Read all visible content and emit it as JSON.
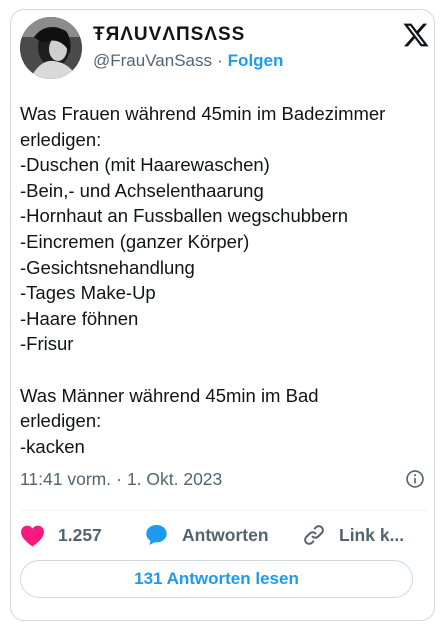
{
  "author": {
    "display_name": "ŦЯΛUVΛПSΛSS",
    "handle": "@FrauVanSass",
    "separator": "·",
    "follow_label": "Folgen"
  },
  "platform_icon": "x-logo-icon",
  "tweet": {
    "lines": [
      "Was Frauen während 45min im Badezimmer",
      "erledigen:",
      "-Duschen (mit Haarewaschen)",
      "-Bein,- und Achselenthaarung",
      "-Hornhaut an Fussballen wegschubbern",
      "-Eincremen (ganzer Körper)",
      "-Gesichtsnehandlung",
      "-Tages Make-Up",
      "-Haare föhnen",
      "-Frisur",
      "",
      "Was Männer während 45min im Bad",
      "erledigen:",
      "-kacken"
    ]
  },
  "meta": {
    "time": "11:41 vorm.",
    "separator": "·",
    "date": "1. Okt. 2023",
    "info_icon": "info-icon"
  },
  "actions": {
    "like_count": "1.257",
    "like_icon": "heart-icon",
    "reply_label": "Antworten",
    "reply_icon": "speech-bubble-icon",
    "link_label": "Link k...",
    "link_icon": "link-icon"
  },
  "read_replies_label": "131 Antworten lesen",
  "colors": {
    "accent": "#1d9bf0",
    "like": "#f91880",
    "text": "#0f1419",
    "muted": "#536471",
    "border": "#cfd9de"
  }
}
